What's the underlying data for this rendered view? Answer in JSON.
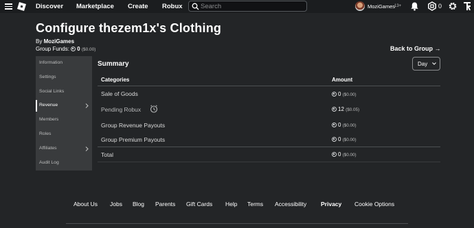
{
  "nav": {
    "discover": "Discover",
    "marketplace": "Marketplace",
    "create": "Create",
    "robux": "Robux",
    "search_placeholder": "Search",
    "username": "MoziGames",
    "age_label": "13+",
    "robux_balance": "0"
  },
  "header": {
    "title": "Configure thezem1x's Clothing",
    "by_prefix": "By",
    "owner": "MoziGames",
    "funds_label": "Group Funds:",
    "funds_amount": "0",
    "funds_usd": "($0.00)",
    "back_link": "Back to Group →"
  },
  "sidebar": {
    "items": [
      {
        "label": "Information"
      },
      {
        "label": "Settings"
      },
      {
        "label": "Social Links"
      },
      {
        "label": "Revenue"
      },
      {
        "label": "Members"
      },
      {
        "label": "Roles"
      },
      {
        "label": "Affiliates"
      },
      {
        "label": "Audit Log"
      }
    ]
  },
  "summary": {
    "title": "Summary",
    "period": "Day",
    "columns": [
      "Categories",
      "Amount"
    ],
    "rows": [
      {
        "category": "Sale of Goods",
        "amount": "0",
        "usd": "($0.00)"
      },
      {
        "category": "Pending Robux",
        "amount": "12",
        "usd": "($0.05)"
      },
      {
        "category": "Group Revenue Payouts",
        "amount": "0",
        "usd": "($0.00)"
      },
      {
        "category": "Group Premium Payouts",
        "amount": "0",
        "usd": "($0.00)"
      }
    ],
    "total": {
      "category": "Total",
      "amount": "0",
      "usd": "($0.00)"
    }
  },
  "footer": {
    "links": [
      "About Us",
      "Jobs",
      "Blog",
      "Parents",
      "Gift Cards",
      "Help",
      "Terms",
      "Accessibility",
      "Privacy",
      "Cookie Options"
    ]
  },
  "colors": {
    "background": "#232527",
    "topbar": "#1b1d1f",
    "sidebar": "#393b3d"
  }
}
